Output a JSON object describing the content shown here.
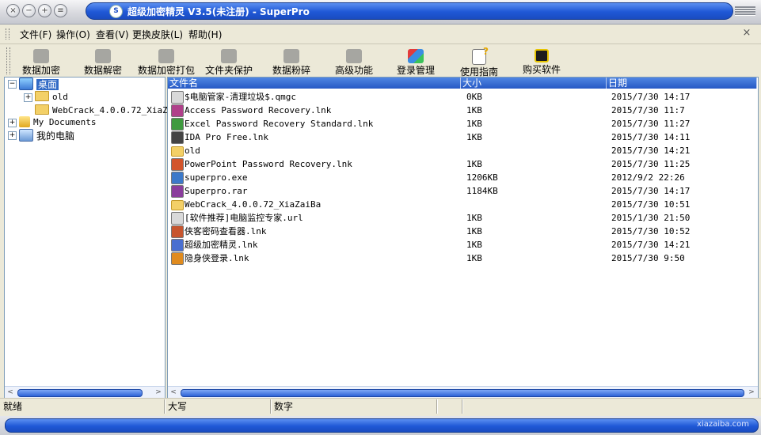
{
  "window": {
    "title": "超级加密精灵 V3.5(未注册) - SuperPro",
    "buttons": [
      "×",
      "−",
      "+",
      "≡"
    ],
    "title_icon": "lock-icon"
  },
  "menu": [
    {
      "label": "文件(F)"
    },
    {
      "label": "操作(O)"
    },
    {
      "label": "查看(V)"
    },
    {
      "label": "更换皮肤(L)"
    },
    {
      "label": "帮助(H)"
    }
  ],
  "menu_close": "×",
  "toolbar": [
    {
      "label": "数据加密",
      "icon": "encrypt-icon",
      "enabled": false
    },
    {
      "label": "数据解密",
      "icon": "decrypt-icon",
      "enabled": false
    },
    {
      "label": "数据加密打包",
      "icon": "package-icon",
      "enabled": false
    },
    {
      "label": "文件夹保护",
      "icon": "folder-protect-icon",
      "enabled": false
    },
    {
      "label": "数据粉碎",
      "icon": "shred-icon",
      "enabled": false
    },
    {
      "label": "高级功能",
      "icon": "advanced-icon",
      "enabled": false
    },
    {
      "label": "登录管理",
      "icon": "login-icon",
      "enabled": true
    },
    {
      "label": "使用指南",
      "icon": "guide-icon",
      "enabled": true
    },
    {
      "label": "购买软件",
      "icon": "buy-icon",
      "enabled": true
    }
  ],
  "tree": [
    {
      "label": "桌面",
      "expander": "−",
      "icon": "desktop-icon",
      "selected": true
    },
    {
      "label": "old",
      "expander": "+",
      "icon": "folder-icon"
    },
    {
      "label": "WebCrack_4.0.0.72_XiaZai",
      "expander": "",
      "icon": "folder-icon"
    },
    {
      "label": "My Documents",
      "expander": "+",
      "icon": "documents-icon"
    },
    {
      "label": "我的电脑",
      "expander": "+",
      "icon": "computer-icon"
    }
  ],
  "file_columns": {
    "name": "文件名",
    "size": "大小",
    "date": "日期"
  },
  "files": [
    {
      "name": "$电脑管家-清理垃圾$.qmgc",
      "size": "0KB",
      "date": "2015/7/30 14:17",
      "icon": "file-icon",
      "color": "#d9d9d9"
    },
    {
      "name": "Access Password Recovery.lnk",
      "size": "1KB",
      "date": "2015/7/30 11:7",
      "icon": "key-app-icon",
      "color": "#b0408a"
    },
    {
      "name": "Excel Password Recovery Standard.lnk",
      "size": "1KB",
      "date": "2015/7/30 11:27",
      "icon": "excel-key-icon",
      "color": "#3f9a3f"
    },
    {
      "name": "IDA Pro Free.lnk",
      "size": "1KB",
      "date": "2015/7/30 14:11",
      "icon": "ida-icon",
      "color": "#444444"
    },
    {
      "name": "old",
      "size": "",
      "date": "2015/7/30 14:21",
      "icon": "folder-icon",
      "color": "#f3d067"
    },
    {
      "name": "PowerPoint Password Recovery.lnk",
      "size": "1KB",
      "date": "2015/7/30 11:25",
      "icon": "powerpoint-key-icon",
      "color": "#d2542b"
    },
    {
      "name": "superpro.exe",
      "size": "1206KB",
      "date": "2012/9/2 22:26",
      "icon": "superpro-icon",
      "color": "#3c79c9"
    },
    {
      "name": "Superpro.rar",
      "size": "1184KB",
      "date": "2015/7/30 14:17",
      "icon": "archive-icon",
      "color": "#8a3d9c"
    },
    {
      "name": "WebCrack_4.0.0.72_XiaZaiBa",
      "size": "",
      "date": "2015/7/30 10:51",
      "icon": "folder-icon",
      "color": "#f3d067"
    },
    {
      "name": "[软件推荐]电脑监控专家.url",
      "size": "1KB",
      "date": "2015/1/30 21:50",
      "icon": "url-icon",
      "color": "#d9d9d9"
    },
    {
      "name": "侠客密码查看器.lnk",
      "size": "1KB",
      "date": "2015/7/30 10:52",
      "icon": "password-viewer-icon",
      "color": "#c7552e"
    },
    {
      "name": "超级加密精灵.lnk",
      "size": "1KB",
      "date": "2015/7/30 14:21",
      "icon": "lock-app-icon",
      "color": "#4a6fd0"
    },
    {
      "name": "隐身侠登录.lnk",
      "size": "1KB",
      "date": "2015/7/30 9:50",
      "icon": "stealth-login-icon",
      "color": "#e08b1e"
    }
  ],
  "status": {
    "ready": "就绪",
    "caps": "大写",
    "num": "数字"
  },
  "watermark": "xiazaiba.com"
}
